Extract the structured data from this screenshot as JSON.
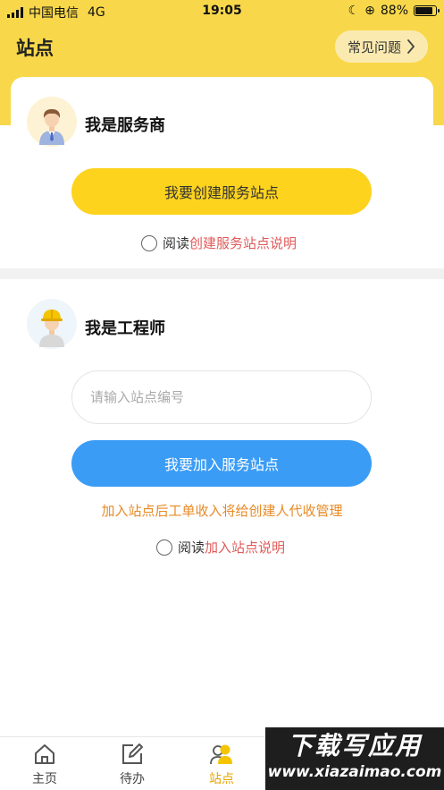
{
  "status_bar": {
    "carrier": "中国电信",
    "network": "4G",
    "time": "19:05",
    "battery": "88%",
    "battery_level": 0.88
  },
  "header": {
    "title": "站点",
    "faq_label": "常见问题"
  },
  "provider_section": {
    "role_title": "我是服务商",
    "create_button": "我要创建服务站点",
    "agree_prefix": "阅读",
    "agree_link": "创建服务站点说明"
  },
  "engineer_section": {
    "role_title": "我是工程师",
    "site_input_placeholder": "请输入站点编号",
    "join_button": "我要加入服务站点",
    "notice": "加入站点后工单收入将给创建人代收管理",
    "agree_prefix": "阅读",
    "agree_link": "加入站点说明"
  },
  "tabbar": {
    "items": [
      {
        "label": "主页",
        "icon": "home-icon"
      },
      {
        "label": "待办",
        "icon": "edit-icon"
      },
      {
        "label": "站点",
        "icon": "people-icon",
        "active": true
      }
    ]
  },
  "watermark": {
    "title": "下载写应用",
    "url": "www.xiazaimao.com"
  },
  "colors": {
    "brand_yellow": "#f8d84a",
    "button_yellow": "#fdd31d",
    "button_blue": "#3b9cf6",
    "link_red": "#e05a5a",
    "notice_orange": "#e88a25",
    "tab_active": "#e6a400"
  }
}
